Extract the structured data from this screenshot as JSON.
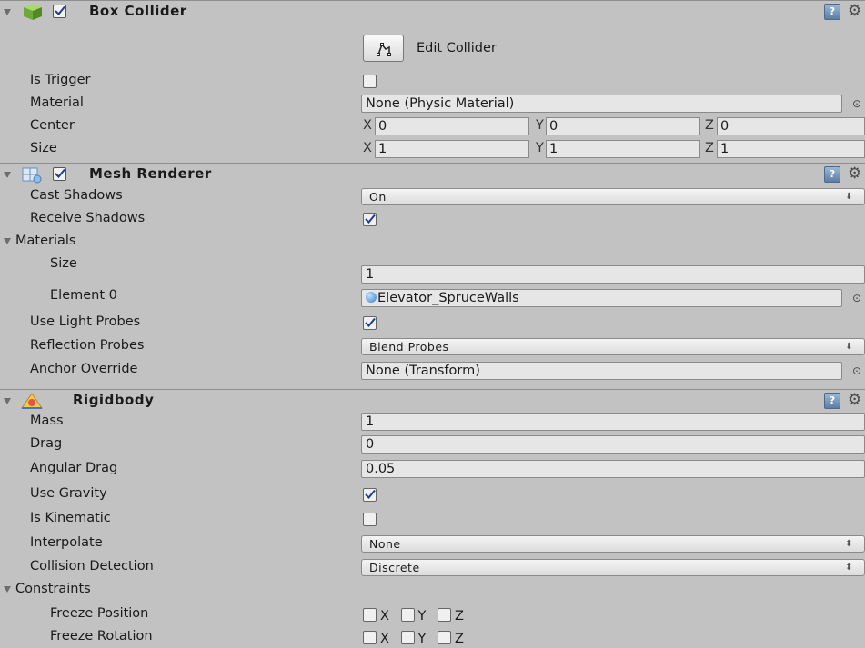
{
  "box_collider": {
    "title": "Box Collider",
    "edit_label": "Edit Collider",
    "is_trigger_label": "Is Trigger",
    "material_label": "Material",
    "material_value": "None (Physic Material)",
    "center_label": "Center",
    "center": {
      "x": "0",
      "y": "0",
      "z": "0"
    },
    "size_label": "Size",
    "size": {
      "x": "1",
      "y": "1",
      "z": "1"
    }
  },
  "mesh_renderer": {
    "title": "Mesh Renderer",
    "cast_shadows_label": "Cast Shadows",
    "cast_shadows_value": "On",
    "receive_shadows_label": "Receive Shadows",
    "materials_label": "Materials",
    "size_label": "Size",
    "size_value": "1",
    "element0_label": "Element 0",
    "element0_value": "Elevator_SpruceWalls",
    "light_probes_label": "Use Light Probes",
    "reflection_label": "Reflection Probes",
    "reflection_value": "Blend Probes",
    "anchor_label": "Anchor Override",
    "anchor_value": "None (Transform)"
  },
  "rigidbody": {
    "title": "Rigidbody",
    "mass_label": "Mass",
    "mass_value": "1",
    "drag_label": "Drag",
    "drag_value": "0",
    "angular_label": "Angular Drag",
    "angular_value": "0.05",
    "gravity_label": "Use Gravity",
    "kinematic_label": "Is Kinematic",
    "interp_label": "Interpolate",
    "interp_value": "None",
    "collision_label": "Collision Detection",
    "collision_value": "Discrete",
    "constraints_label": "Constraints",
    "freeze_pos_label": "Freeze Position",
    "freeze_rot_label": "Freeze Rotation"
  },
  "axis": {
    "x": "X",
    "y": "Y",
    "z": "Z"
  },
  "colors": {
    "panel": "#c2c2c2",
    "field": "#e6e6e6",
    "help": "#5c7ea4"
  },
  "icons": [
    "cube-icon",
    "mesh-renderer-icon",
    "rigidbody-icon",
    "help-icon",
    "gear-icon",
    "object-picker-icon",
    "edit-collider-icon"
  ]
}
